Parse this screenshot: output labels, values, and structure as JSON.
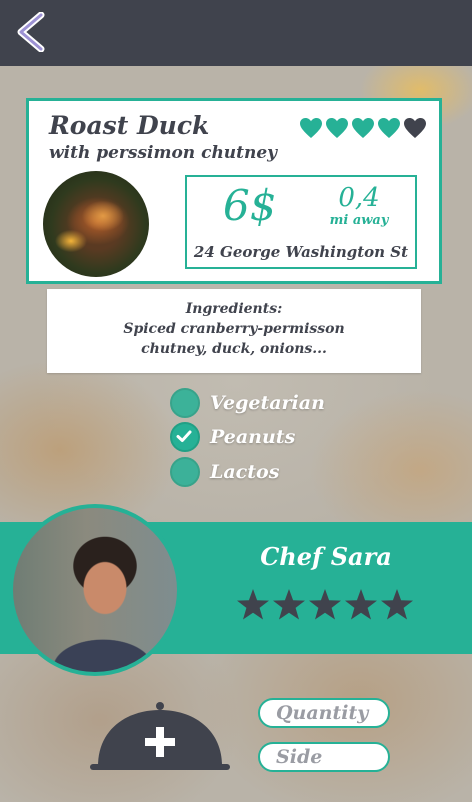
{
  "header": {
    "back_icon": "chevron-left-icon"
  },
  "dish": {
    "title": "Roast Duck",
    "subtitle": "with perssimon chutney",
    "rating": {
      "filled": 4,
      "max": 5,
      "icon": "heart-icon"
    },
    "price": "6$",
    "distance": "0,4",
    "distance_unit": "mi away",
    "address": "24 George Washington St"
  },
  "ingredients": {
    "heading": "Ingredients:",
    "line1": "Spiced cranberry-permisson",
    "line2": "chutney, duck, onions..."
  },
  "options": [
    {
      "label": "Vegetarian",
      "checked": false
    },
    {
      "label": "Peanuts",
      "checked": true
    },
    {
      "label": "Lactos",
      "checked": false
    }
  ],
  "chef": {
    "name": "Chef Sara",
    "rating": {
      "filled": 5,
      "max": 5,
      "icon": "star-icon"
    }
  },
  "order": {
    "add_icon": "plus-icon",
    "quantity_placeholder": "Quantity",
    "side_placeholder": "Side"
  },
  "colors": {
    "accent": "#26b196",
    "dark": "#40434d",
    "back_icon": "#9d92d4"
  }
}
